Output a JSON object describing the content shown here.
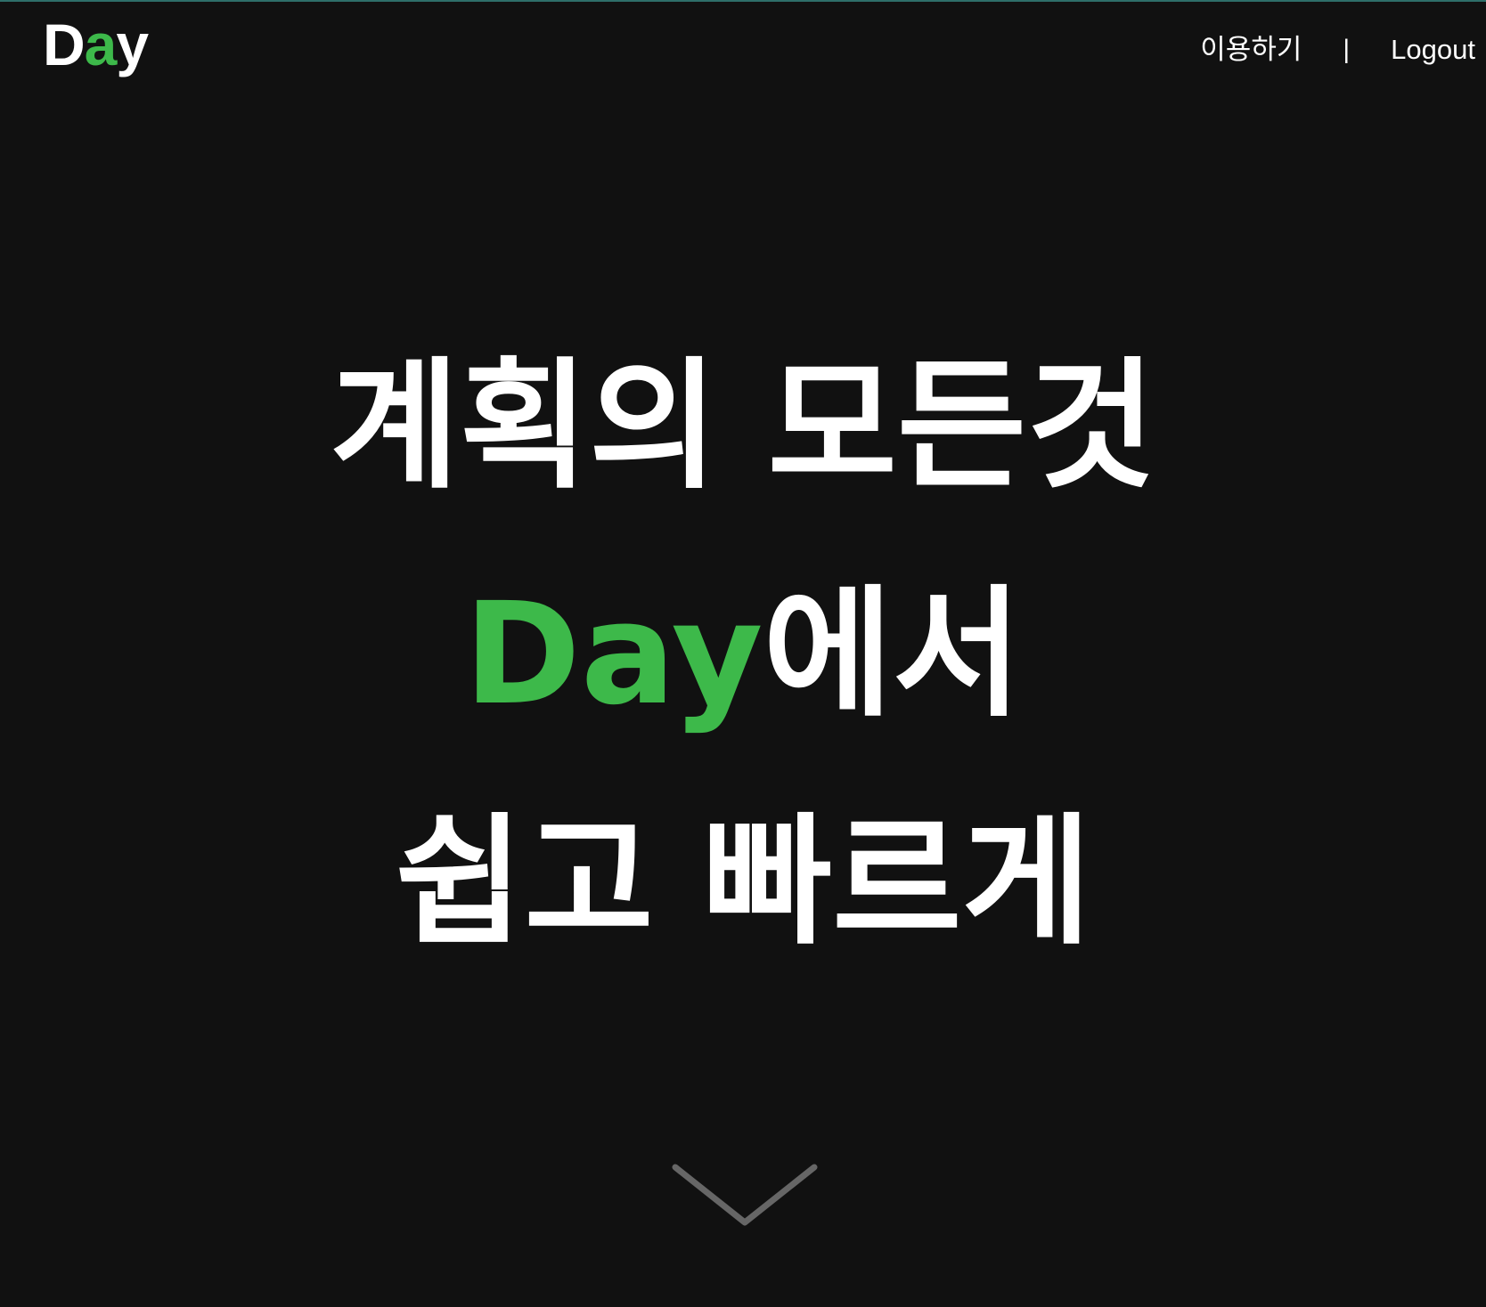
{
  "header": {
    "logo": {
      "part1": "D",
      "part2": "a",
      "part3": "y"
    },
    "nav": {
      "use_label": "이용하기",
      "separator": "|",
      "logout_label": "Logout"
    }
  },
  "hero": {
    "line1": "계획의 모든것",
    "line2_brand": "Day",
    "line2_rest": "에서",
    "line3": "쉽고 빠르게"
  },
  "scroll_indicator": {
    "icon": "chevron-down-icon"
  },
  "colors": {
    "background": "#111111",
    "brand_green": "#3db94a",
    "text": "#ffffff",
    "chevron": "#666666"
  }
}
